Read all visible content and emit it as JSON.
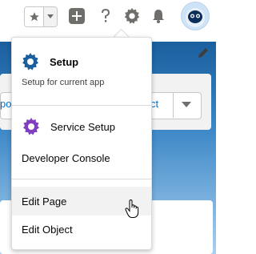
{
  "header": {
    "favorites_icon": "star-icon",
    "favorites_menu_icon": "chevron-down-icon",
    "global_actions_icon": "plus-icon",
    "help_icon": "question-icon",
    "setup_icon": "gear-icon",
    "notifications_icon": "bell-icon",
    "avatar_icon": "astro-avatar"
  },
  "background": {
    "field_left_text": "po",
    "field_right_text": "ct"
  },
  "menu": {
    "setup": {
      "title": "Setup",
      "subtitle": "Setup for current app",
      "icon": "gear-icon"
    },
    "service_setup": {
      "label": "Service Setup",
      "icon": "gear-icon"
    },
    "developer_console": {
      "label": "Developer Console"
    },
    "edit_page": {
      "label": "Edit Page"
    },
    "edit_object": {
      "label": "Edit Object"
    }
  },
  "colors": {
    "setup_icon": "#1b5f9e",
    "service_setup_icon": "#7f3fbf",
    "hover_row": "#f3f2f2",
    "link_blue": "#0070d2"
  }
}
